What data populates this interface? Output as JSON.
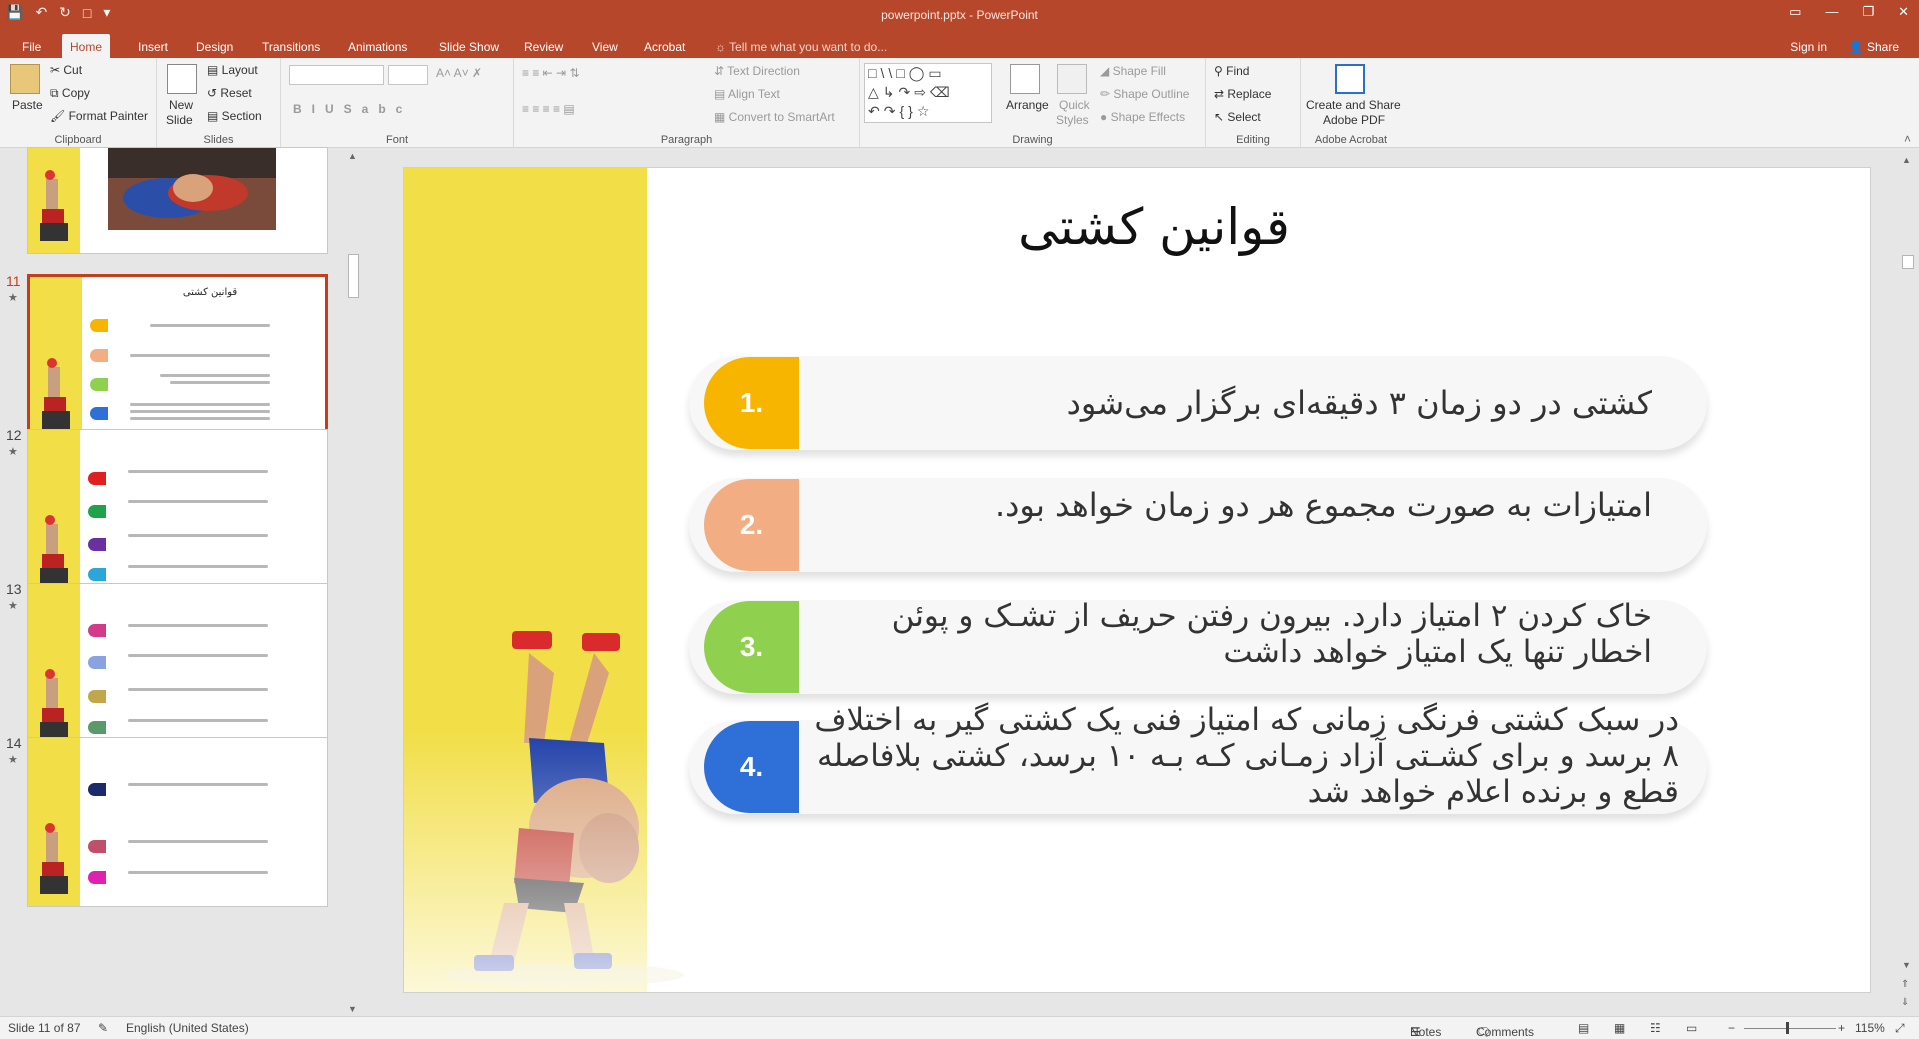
{
  "window": {
    "title": "powerpoint.pptx - PowerPoint",
    "sign_in": "Sign in",
    "share": "Share",
    "tell_me": "Tell me what you want to do..."
  },
  "tabs": [
    "File",
    "Home",
    "Insert",
    "Design",
    "Transitions",
    "Animations",
    "Slide Show",
    "Review",
    "View",
    "Acrobat"
  ],
  "ribbon": {
    "clipboard": {
      "label": "Clipboard",
      "paste": "Paste",
      "cut": "Cut",
      "copy": "Copy",
      "format_painter": "Format Painter"
    },
    "slides": {
      "label": "Slides",
      "new_slide": "New",
      "new_slide2": "Slide",
      "layout": "Layout",
      "reset": "Reset",
      "section": "Section"
    },
    "font": {
      "label": "Font"
    },
    "paragraph": {
      "label": "Paragraph",
      "text_direction": "Text Direction",
      "align_text": "Align Text",
      "convert_smartart": "Convert to SmartArt"
    },
    "drawing": {
      "label": "Drawing",
      "arrange": "Arrange",
      "quick_styles": "Quick",
      "quick_styles2": "Styles",
      "shape_fill": "Shape Fill",
      "shape_outline": "Shape Outline",
      "shape_effects": "Shape Effects"
    },
    "editing": {
      "label": "Editing",
      "find": "Find",
      "replace": "Replace",
      "select": "Select"
    },
    "acrobat": {
      "label": "Adobe Acrobat",
      "create": "Create and Share",
      "create2": "Adobe PDF"
    }
  },
  "thumbnails": [
    {
      "num": "11",
      "title": "قوانین کشتی"
    },
    {
      "num": "12"
    },
    {
      "num": "13"
    },
    {
      "num": "14"
    }
  ],
  "slide": {
    "title": "قوانین کشتی",
    "items": [
      {
        "num": "1.",
        "text": "کشتی در دو زمان ۳ دقیقه‌ای برگزار می‌شود",
        "color": "#f7b500"
      },
      {
        "num": "2.",
        "text": "امتیازات به صورت مجموع هر دو زمان خواهد بود.",
        "color": "#f2ad82"
      },
      {
        "num": "3.",
        "text": "خاک کردن ۲ امتیاز دارد. بیرون رفتن حریف از تشـک و پوئن اخطار تنها یک امتیاز خواهد داشت",
        "color": "#8fd14f"
      },
      {
        "num": "4.",
        "text": "در سبک کشتی فرنگی زمانی که امتیاز فنی یک کشتی گیر به اختلاف ۸ برسد و برای کشـتی آزاد زمـانی کـه بـه ۱۰ برسد، کشتی بلافاصله قطع و برنده اعلام خواهد شد",
        "color": "#2f6fd8"
      }
    ]
  },
  "status": {
    "slide_info": "Slide 11 of 87",
    "language": "English (United States)",
    "notes": "Notes",
    "comments": "Comments",
    "zoom": "115%"
  }
}
